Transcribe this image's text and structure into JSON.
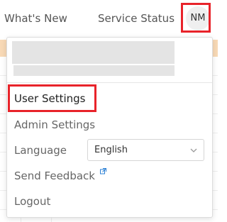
{
  "header": {
    "whats_new": "What's New",
    "service_status": "Service Status",
    "avatar_initials": "NM"
  },
  "menu": {
    "user_settings": "User Settings",
    "admin_settings": "Admin Settings",
    "language_label": "Language",
    "language_value": "English",
    "send_feedback": "Send Feedback",
    "logout": "Logout"
  },
  "colors": {
    "highlight": "#e8232a",
    "banner": "#f8d9b6",
    "link_accent": "#2a7fd4"
  },
  "icons": {
    "language_dropdown": "chevron-down-icon",
    "send_feedback": "external-link-icon"
  }
}
